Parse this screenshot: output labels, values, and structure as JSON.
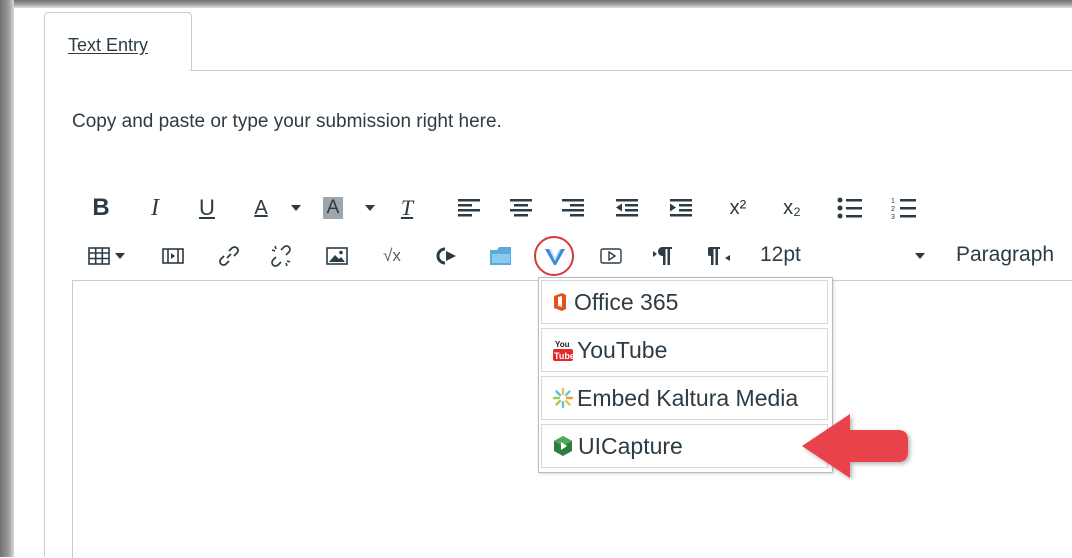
{
  "tabs": [
    {
      "label": "Text Entry"
    }
  ],
  "instructions": "Copy and paste or type your submission right here.",
  "toolbar": {
    "row1": [
      {
        "name": "bold",
        "glyph": "B"
      },
      {
        "name": "italic",
        "glyph": "I"
      },
      {
        "name": "underline",
        "glyph": "U"
      },
      {
        "name": "text-color",
        "glyph": "A"
      },
      {
        "name": "background-color",
        "glyph": "A"
      },
      {
        "name": "clear-formatting",
        "glyph": "T"
      },
      {
        "name": "superscript",
        "glyph": "x²"
      },
      {
        "name": "subscript",
        "glyph": "x₂"
      }
    ],
    "font_size": "12pt",
    "block_format": "Paragraph"
  },
  "menu": {
    "items": [
      {
        "label": "Office 365",
        "icon": "office-365-icon"
      },
      {
        "label": "YouTube",
        "icon": "youtube-icon"
      },
      {
        "label": "Embed Kaltura Media",
        "icon": "kaltura-icon"
      },
      {
        "label": "UICapture",
        "icon": "uicapture-icon"
      }
    ]
  },
  "colors": {
    "text": "#2d3b45",
    "highlight": "#d9363e",
    "arrow": "#e8434c",
    "border": "#c7cdd1"
  }
}
